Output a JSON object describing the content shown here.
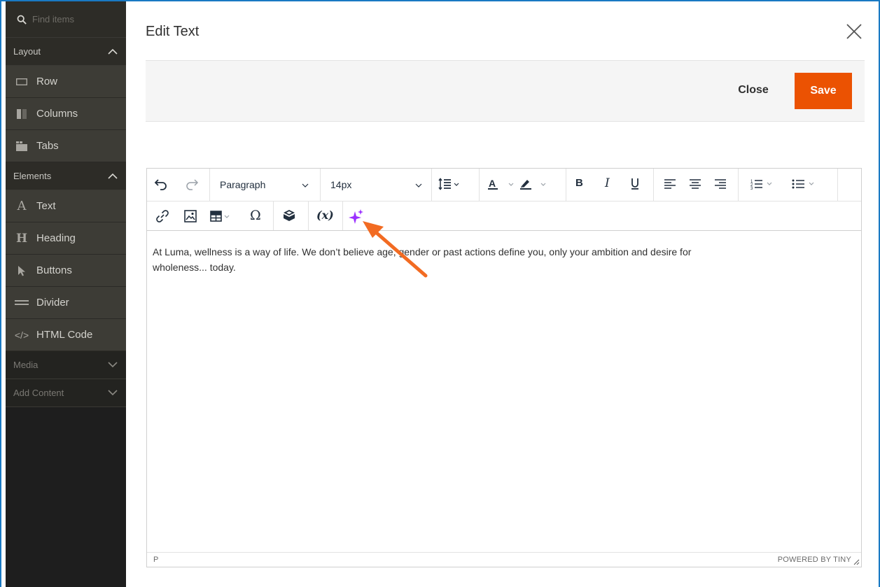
{
  "sidebar": {
    "search_placeholder": "Find items",
    "groups": {
      "layout": {
        "label": "Layout",
        "items": [
          "Row",
          "Columns",
          "Tabs"
        ]
      },
      "elements": {
        "label": "Elements",
        "items": [
          "Text",
          "Heading",
          "Buttons",
          "Divider",
          "HTML Code"
        ]
      },
      "media": {
        "label": "Media"
      },
      "add_content": {
        "label": "Add Content"
      }
    }
  },
  "modal": {
    "title": "Edit Text",
    "close_label": "Close",
    "save_label": "Save"
  },
  "toolbar": {
    "block_format": "Paragraph",
    "font_size": "14px"
  },
  "editor": {
    "content_line1": "At Luma, wellness is a way of life. We don’t believe age, gender or past actions define you, only your ambition and desire for",
    "content_line2": "wholeness... today.",
    "status_path": "P",
    "branding": "POWERED BY TINY"
  },
  "colors": {
    "accent": "#eb5202",
    "ai_icon": "#9b30ff",
    "arrow": "#f26b22",
    "sidebar_bg": "#3d3c36",
    "frame_border": "#1979c3"
  },
  "icons": [
    "search-icon",
    "chevron-up-icon",
    "chevron-down-icon",
    "row-icon",
    "columns-icon",
    "tabs-icon",
    "text-icon",
    "heading-icon",
    "cursor-icon",
    "divider-icon",
    "code-icon",
    "close-icon",
    "undo-icon",
    "redo-icon",
    "line-height-icon",
    "text-color-icon",
    "highlight-icon",
    "bold-icon",
    "italic-icon",
    "underline-icon",
    "align-left-icon",
    "align-center-icon",
    "align-right-icon",
    "numbered-list-icon",
    "bullet-list-icon",
    "link-icon",
    "image-icon",
    "table-icon",
    "omega-icon",
    "widget-icon",
    "variable-icon",
    "ai-sparkle-icon",
    "resize-handle-icon"
  ]
}
